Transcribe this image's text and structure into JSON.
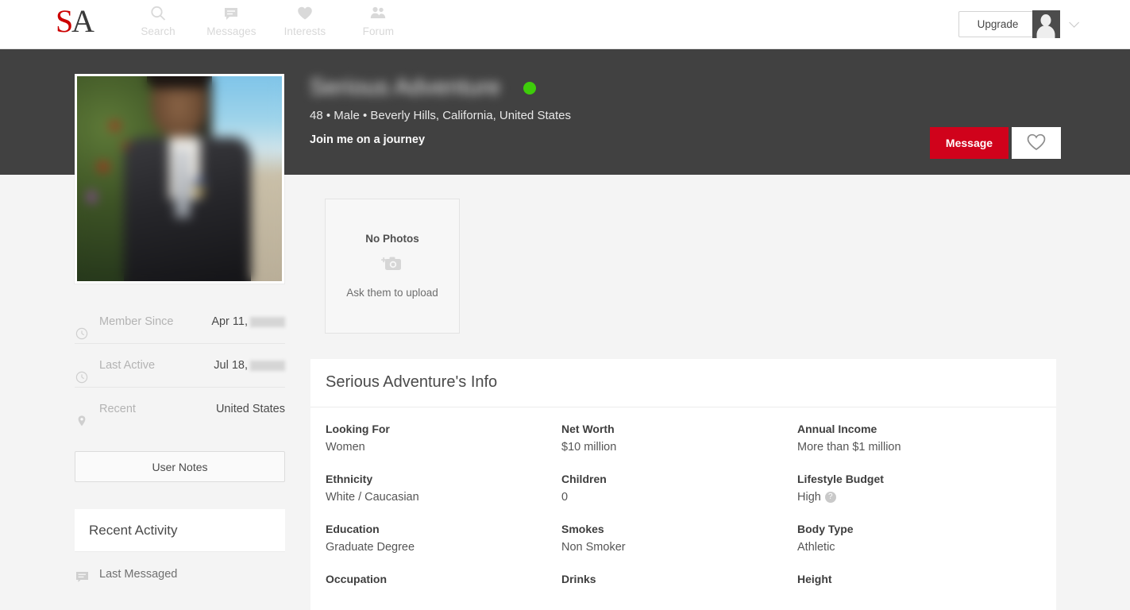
{
  "nav": {
    "logo_text": "SA",
    "items": [
      {
        "label": "Search",
        "icon": "search-icon"
      },
      {
        "label": "Messages",
        "icon": "message-icon"
      },
      {
        "label": "Interests",
        "icon": "heart-icon"
      },
      {
        "label": "Forum",
        "icon": "people-icon"
      }
    ],
    "upgrade_label": "Upgrade",
    "avatar_icon": "user-avatar-icon",
    "caret_icon": "chevron-down-icon"
  },
  "profile": {
    "name": "Serious Adventure",
    "name_blurred": true,
    "online": true,
    "online_color": "#3ecc0a",
    "meta": "48 • Male • Beverly Hills, California, United States",
    "age": "48",
    "gender": "Male",
    "location": "Beverly Hills, California, United States",
    "tagline": "Join me on a journey",
    "message_button": "Message",
    "message_button_color": "#d0021b",
    "favorite_icon": "heart-outline-icon",
    "photo_alt": "profile-photo"
  },
  "sidebar": {
    "meta_rows": [
      {
        "icon": "clock-icon",
        "label": "Member Since",
        "value": "Apr 11,",
        "redacted": true
      },
      {
        "icon": "clock-icon",
        "label": "Last Active",
        "value": "Jul 18,",
        "redacted": true
      },
      {
        "icon": "pin-icon",
        "label": "Recent",
        "value": "United States",
        "redacted": false
      }
    ],
    "user_notes_label": "User Notes",
    "activity": {
      "title": "Recent Activity",
      "rows": [
        {
          "icon": "message-icon",
          "label": "Last Messaged"
        }
      ]
    }
  },
  "photos": {
    "title": "No Photos",
    "icon": "camera-plus-icon",
    "subtitle": "Ask them to upload"
  },
  "info": {
    "heading": "Serious Adventure's Info",
    "fields": [
      {
        "key": "Looking For",
        "value": "Women",
        "hint": false
      },
      {
        "key": "Net Worth",
        "value": "$10 million",
        "hint": false
      },
      {
        "key": "Annual Income",
        "value": "More than $1 million",
        "hint": false
      },
      {
        "key": "Ethnicity",
        "value": "White / Caucasian",
        "hint": false
      },
      {
        "key": "Children",
        "value": "0",
        "hint": false
      },
      {
        "key": "Lifestyle Budget",
        "value": "High",
        "hint": true
      },
      {
        "key": "Education",
        "value": "Graduate Degree",
        "hint": false
      },
      {
        "key": "Smokes",
        "value": "Non Smoker",
        "hint": false
      },
      {
        "key": "Body Type",
        "value": "Athletic",
        "hint": false
      },
      {
        "key": "Occupation",
        "value": "",
        "hint": false
      },
      {
        "key": "Drinks",
        "value": "",
        "hint": false
      },
      {
        "key": "Height",
        "value": "",
        "hint": false
      }
    ],
    "hint_glyph": "?"
  }
}
